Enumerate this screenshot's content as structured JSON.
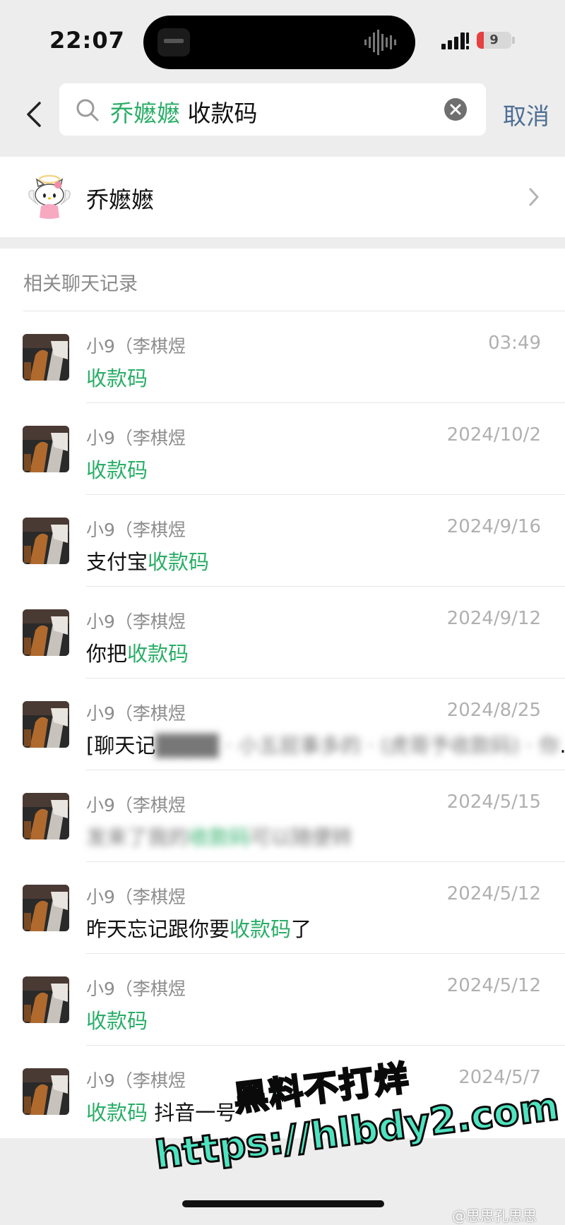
{
  "status_bar": {
    "time": "22:07",
    "battery": "9",
    "battery_level": 0.09
  },
  "search": {
    "back_icon": "chevron-left-icon",
    "keyword_green": "乔嬷嬷",
    "keyword_plain": "收款码",
    "clear_icon": "clear-icon",
    "cancel_label": "取消"
  },
  "contact": {
    "name": "乔嬷嬷",
    "avatar": "hello-kitty-angel-avatar"
  },
  "section_title": "相关聊天记录",
  "messages": [
    {
      "name": "小9（李棋煜",
      "date": "03:49",
      "pre": "",
      "hl": "收款码",
      "post": ""
    },
    {
      "name": "小9（李棋煜",
      "date": "2024/10/2",
      "pre": "",
      "hl": "收款码",
      "post": ""
    },
    {
      "name": "小9（李棋煜",
      "date": "2024/9/16",
      "pre": "支付宝",
      "hl": "收款码",
      "post": ""
    },
    {
      "name": "小9（李棋煜",
      "date": "2024/9/12",
      "pre": "你把",
      "hl": "收款码",
      "post": ""
    },
    {
      "name": "小9（李棋煜",
      "date": "2024/8/25",
      "pre": "[聊天记",
      "hl": "",
      "post": "…"
    },
    {
      "name": "小9（李棋煜",
      "date": "2024/5/15",
      "pre": "",
      "hl": "",
      "post": ""
    },
    {
      "name": "小9（李棋煜",
      "date": "2024/5/12",
      "pre": "昨天忘记跟你要",
      "hl": "收款码",
      "post": "了"
    },
    {
      "name": "小9（李棋煜",
      "date": "2024/5/12",
      "pre": "",
      "hl": "收款码",
      "post": ""
    },
    {
      "name": "小9（李棋煜",
      "date": "2024/5/7",
      "pre": "",
      "hl": "收款码",
      "post": " 抖音一号"
    }
  ],
  "watermark": {
    "line1": "黑料不打烊",
    "line2": "https://hlbdy2.com"
  },
  "weibo_mark": "@思思孔思思"
}
